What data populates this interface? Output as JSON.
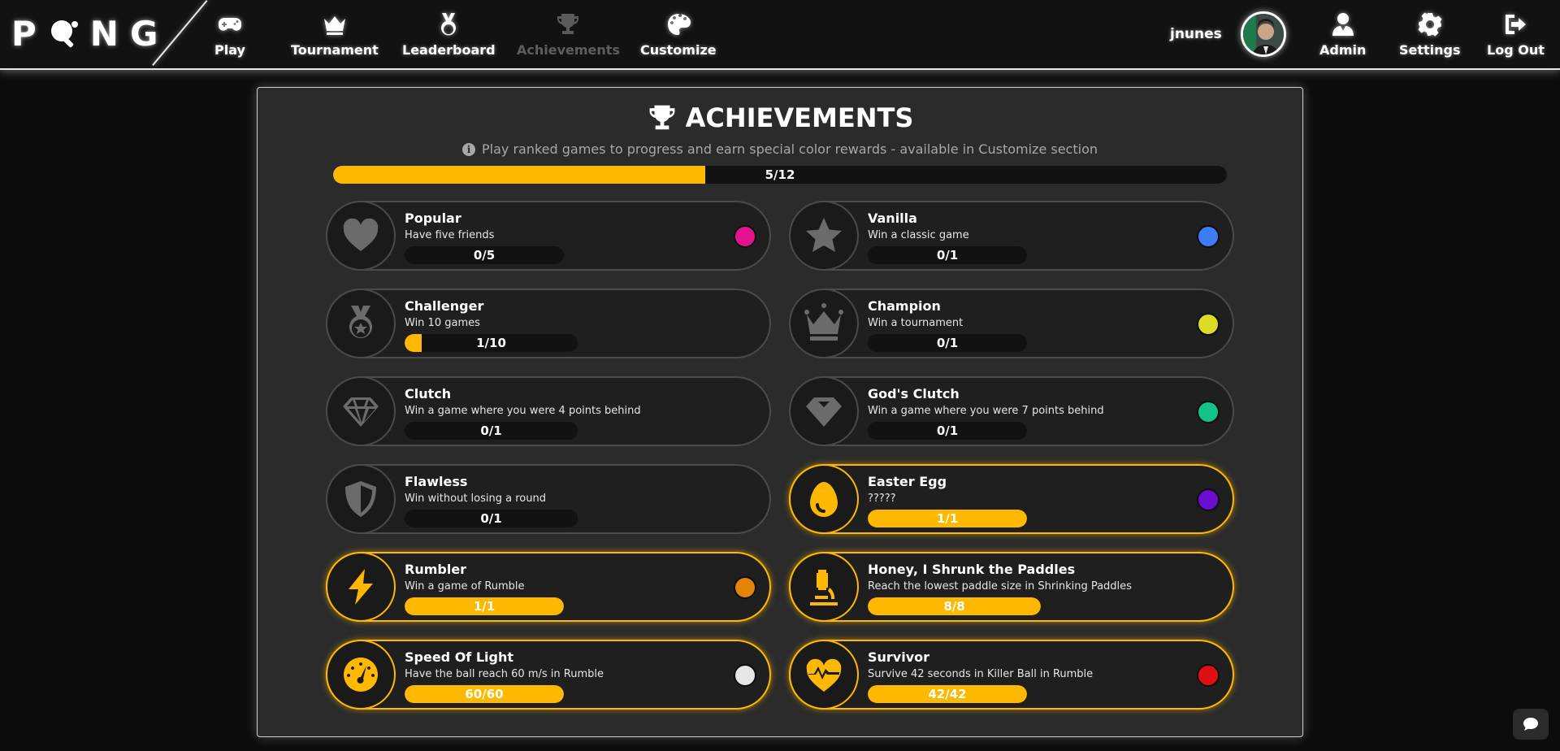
{
  "nav": {
    "logo": "PONG",
    "items": {
      "play": "Play",
      "tournament": "Tournament",
      "leaderboard": "Leaderboard",
      "achievements": "Achievements",
      "customize": "Customize",
      "admin": "Admin",
      "settings": "Settings",
      "logout": "Log Out"
    },
    "username": "jnunes"
  },
  "panel": {
    "title": "ACHIEVEMENTS",
    "subtitle": "Play ranked games to progress and earn special color rewards - available in Customize section",
    "overall": {
      "label": "5/12",
      "completed": 5,
      "total": 12
    }
  },
  "achievements": [
    {
      "title": "Popular",
      "desc": "Have five friends",
      "progress": "0/5",
      "value": 0,
      "max": 5,
      "color": "#e5128d",
      "icon": "heart-icon",
      "done": false
    },
    {
      "title": "Vanilla",
      "desc": "Win a classic game",
      "progress": "0/1",
      "value": 0,
      "max": 1,
      "color": "#3d7cf5",
      "icon": "star-icon",
      "done": false
    },
    {
      "title": "Challenger",
      "desc": "Win 10 games",
      "progress": "1/10",
      "value": 1,
      "max": 10,
      "color": "",
      "icon": "medal-icon",
      "done": false
    },
    {
      "title": "Champion",
      "desc": "Win a tournament",
      "progress": "0/1",
      "value": 0,
      "max": 1,
      "color": "#dcdc22",
      "icon": "crown-icon",
      "done": false
    },
    {
      "title": "Clutch",
      "desc": "Win a game where you were 4 points behind",
      "progress": "0/1",
      "value": 0,
      "max": 1,
      "color": "",
      "icon": "gem-icon",
      "done": false
    },
    {
      "title": "God's Clutch",
      "desc": "Win a game where you were 7 points behind",
      "progress": "0/1",
      "value": 0,
      "max": 1,
      "color": "#12c48b",
      "icon": "gem-solid-icon",
      "done": false
    },
    {
      "title": "Flawless",
      "desc": "Win without losing a round",
      "progress": "0/1",
      "value": 0,
      "max": 1,
      "color": "",
      "icon": "shield-icon",
      "done": false
    },
    {
      "title": "Easter Egg",
      "desc": "?????",
      "progress": "1/1",
      "value": 1,
      "max": 1,
      "color": "#6a0fd1",
      "icon": "egg-icon",
      "done": true
    },
    {
      "title": "Rumbler",
      "desc": "Win a game of Rumble",
      "progress": "1/1",
      "value": 1,
      "max": 1,
      "color": "#e38308",
      "icon": "bolt-icon",
      "done": true
    },
    {
      "title": "Honey, I Shrunk the Paddles",
      "desc": "Reach the lowest paddle size in Shrinking Paddles",
      "progress": "8/8",
      "value": 8,
      "max": 8,
      "color": "",
      "icon": "microscope-icon",
      "done": true
    },
    {
      "title": "Speed Of Light",
      "desc": "Have the ball reach 60 m/s in Rumble",
      "progress": "60/60",
      "value": 60,
      "max": 60,
      "color": "#e6e6e6",
      "icon": "speedometer-icon",
      "done": true
    },
    {
      "title": "Survivor",
      "desc": "Survive 42 seconds in Killer Ball in Rumble",
      "progress": "42/42",
      "value": 42,
      "max": 42,
      "color": "#e01010",
      "icon": "heartbeat-icon",
      "done": true
    }
  ]
}
